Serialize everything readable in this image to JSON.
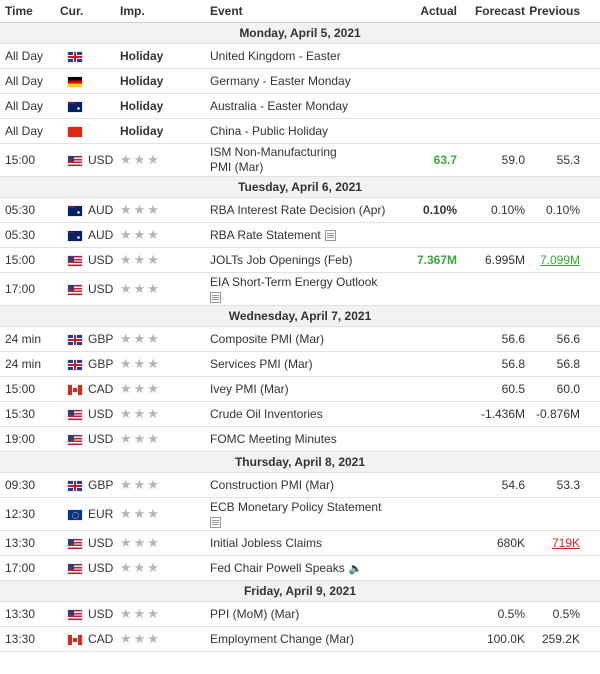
{
  "headers": {
    "time": "Time",
    "cur": "Cur.",
    "imp": "Imp.",
    "event": "Event",
    "actual": "Actual",
    "forecast": "Forecast",
    "previous": "Previous"
  },
  "days": [
    {
      "label": "Monday, April 5, 2021",
      "rows": [
        {
          "time": "All Day",
          "flag": "gb",
          "cur": "",
          "imp": "Holiday",
          "event": "United Kingdom - Easter",
          "actual": "",
          "forecast": "",
          "previous": ""
        },
        {
          "time": "All Day",
          "flag": "de",
          "cur": "",
          "imp": "Holiday",
          "event": "Germany - Easter Monday",
          "actual": "",
          "forecast": "",
          "previous": ""
        },
        {
          "time": "All Day",
          "flag": "au",
          "cur": "",
          "imp": "Holiday",
          "event": "Australia - Easter Monday",
          "actual": "",
          "forecast": "",
          "previous": ""
        },
        {
          "time": "All Day",
          "flag": "cn",
          "cur": "",
          "imp": "Holiday",
          "event": "China - Public Holiday",
          "actual": "",
          "forecast": "",
          "previous": ""
        },
        {
          "time": "15:00",
          "flag": "us",
          "cur": "USD",
          "imp": "★★★",
          "event": "ISM Non-Manufacturing PMI (Mar)",
          "actual": "63.7",
          "forecast": "59.0",
          "previous": "55.3"
        }
      ]
    },
    {
      "label": "Tuesday, April 6, 2021",
      "rows": [
        {
          "time": "05:30",
          "flag": "au",
          "cur": "AUD",
          "imp": "★★★",
          "event": "RBA Interest Rate Decision (Apr)",
          "actual": "0.10%",
          "forecast": "0.10%",
          "previous": "0.10%"
        },
        {
          "time": "05:30",
          "flag": "au",
          "cur": "AUD",
          "imp": "★★★",
          "event": "RBA Rate Statement",
          "actual": "",
          "forecast": "",
          "previous": ""
        },
        {
          "time": "15:00",
          "flag": "us",
          "cur": "USD",
          "imp": "★★★",
          "event": "JOLTs Job Openings (Feb)",
          "actual": "7.367M",
          "forecast": "6.995M",
          "previous": "7.099M"
        },
        {
          "time": "17:00",
          "flag": "us",
          "cur": "USD",
          "imp": "★★★",
          "event": "EIA Short-Term Energy Outlook",
          "actual": "",
          "forecast": "",
          "previous": ""
        }
      ]
    },
    {
      "label": "Wednesday, April 7, 2021",
      "rows": [
        {
          "time": "24 min",
          "flag": "gb",
          "cur": "GBP",
          "imp": "★★★",
          "event": "Composite PMI (Mar)",
          "actual": "",
          "forecast": "56.6",
          "previous": "56.6"
        },
        {
          "time": "24 min",
          "flag": "gb",
          "cur": "GBP",
          "imp": "★★★",
          "event": "Services PMI (Mar)",
          "actual": "",
          "forecast": "56.8",
          "previous": "56.8"
        },
        {
          "time": "15:00",
          "flag": "ca",
          "cur": "CAD",
          "imp": "★★★",
          "event": "Ivey PMI (Mar)",
          "actual": "",
          "forecast": "60.5",
          "previous": "60.0"
        },
        {
          "time": "15:30",
          "flag": "us",
          "cur": "USD",
          "imp": "★★★",
          "event": "Crude Oil Inventories",
          "actual": "",
          "forecast": "-1.436M",
          "previous": "-0.876M"
        },
        {
          "time": "19:00",
          "flag": "us",
          "cur": "USD",
          "imp": "★★★",
          "event": "FOMC Meeting Minutes",
          "actual": "",
          "forecast": "",
          "previous": ""
        }
      ]
    },
    {
      "label": "Thursday, April 8, 2021",
      "rows": [
        {
          "time": "09:30",
          "flag": "gb",
          "cur": "GBP",
          "imp": "★★★",
          "event": "Construction PMI (Mar)",
          "actual": "",
          "forecast": "54.6",
          "previous": "53.3"
        },
        {
          "time": "12:30",
          "flag": "eu",
          "cur": "EUR",
          "imp": "★★★",
          "event": "ECB Monetary Policy Statement",
          "actual": "",
          "forecast": "",
          "previous": ""
        },
        {
          "time": "13:30",
          "flag": "us",
          "cur": "USD",
          "imp": "★★★",
          "event": "Initial Jobless Claims",
          "actual": "",
          "forecast": "680K",
          "previous": "719K"
        },
        {
          "time": "17:00",
          "flag": "us",
          "cur": "USD",
          "imp": "★★★",
          "event": "Fed Chair Powell Speaks",
          "actual": "",
          "forecast": "",
          "previous": ""
        }
      ]
    },
    {
      "label": "Friday, April 9, 2021",
      "rows": [
        {
          "time": "13:30",
          "flag": "us",
          "cur": "USD",
          "imp": "★★★",
          "event": "PPI (MoM) (Mar)",
          "actual": "",
          "forecast": "0.5%",
          "previous": "0.5%"
        },
        {
          "time": "13:30",
          "flag": "ca",
          "cur": "CAD",
          "imp": "★★★",
          "event": "Employment Change (Mar)",
          "actual": "",
          "forecast": "100.0K",
          "previous": "259.2K"
        }
      ]
    }
  ],
  "colors": {
    "actual_better": "#3aa63a",
    "previous_revised_down": "#dd2222",
    "star_gray": "#b5b5b5",
    "day_header_bg": "#f2f2f2"
  },
  "icons": {
    "report": "document-icon",
    "speech": "speaker-icon"
  }
}
